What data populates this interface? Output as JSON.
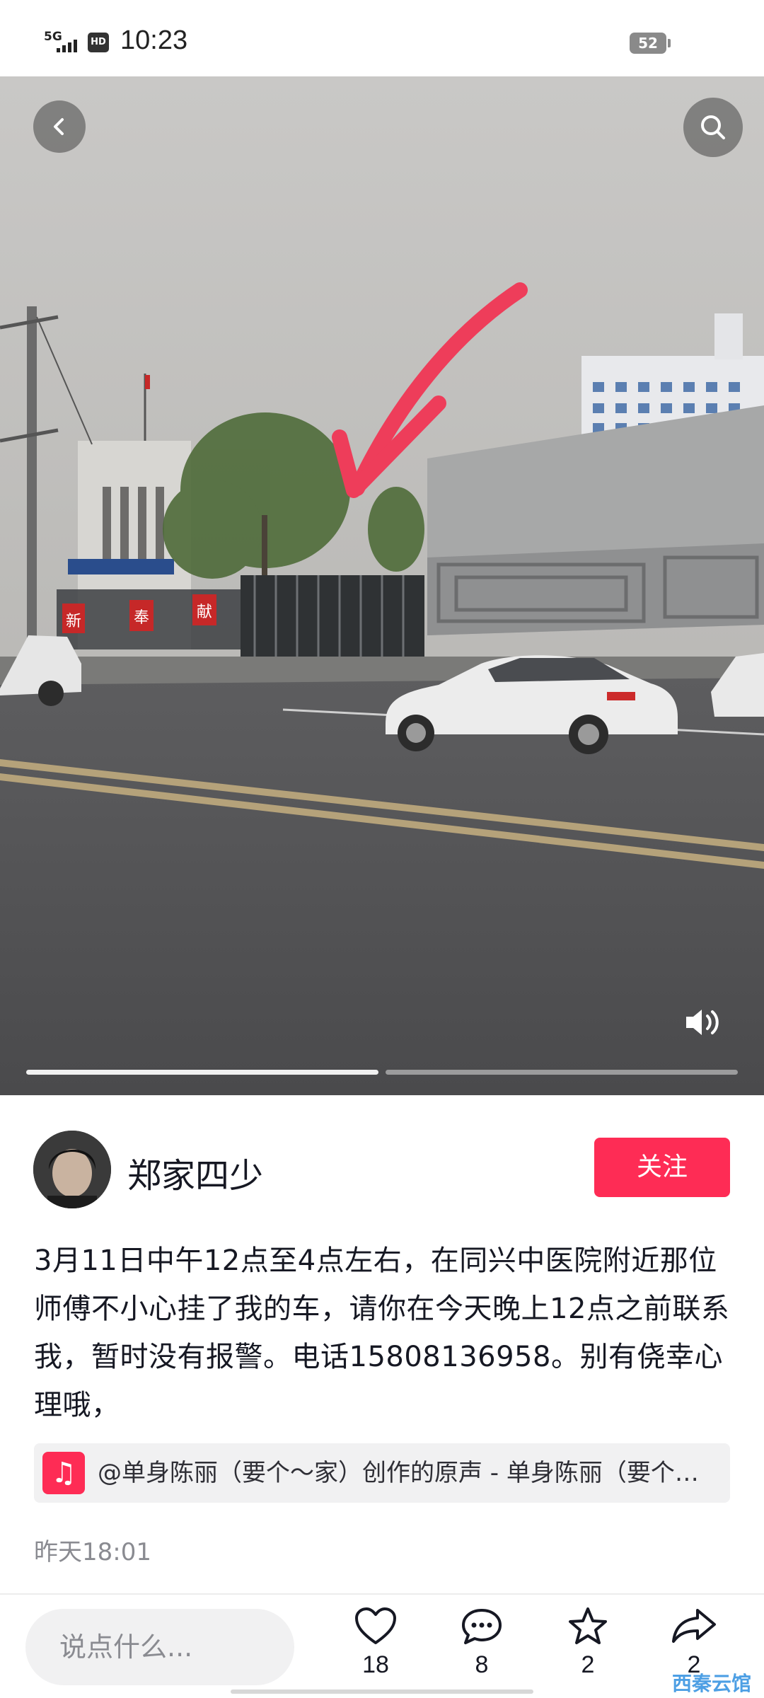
{
  "status_bar": {
    "network": "5G",
    "hd_badge": "HD",
    "time": "10:23",
    "battery": "52"
  },
  "media": {
    "slide_count": 2,
    "active_slide": 1,
    "sign_chars": [
      "新",
      "奉",
      "献"
    ],
    "annotation_arrow_color": "#ee3d5a"
  },
  "author": {
    "name": "郑家四少",
    "follow_label": "关注"
  },
  "post": {
    "caption": "3月11日中午12点至4点左右，在同兴中医院附近那位师傅不小心挂了我的车，请你在今天晚上12点之前联系我，暂时没有报警。电话15808136958。别有侥幸心理哦，",
    "music": "@单身陈丽（要个～家）创作的原声 - 单身陈丽（要个～家）",
    "time": "昨天18:01"
  },
  "bottom_bar": {
    "comment_placeholder": "说点什么...",
    "likes": "18",
    "comments": "8",
    "favorites": "2",
    "shares": "2"
  },
  "watermark": "西秦云馆",
  "colors": {
    "accent": "#fe2c55",
    "text": "#161823",
    "muted": "#8a8b91"
  },
  "icons": [
    "back-icon",
    "search-icon",
    "volume-icon",
    "music-note-icon",
    "heart-icon",
    "comment-icon",
    "star-icon",
    "share-icon"
  ]
}
